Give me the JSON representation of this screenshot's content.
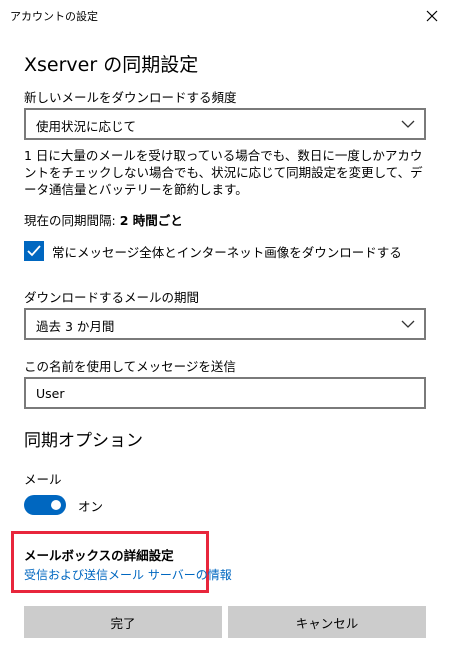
{
  "window": {
    "title": "アカウントの設定",
    "close_icon": "close-icon"
  },
  "heading": "Xserver の同期設定",
  "download_frequency": {
    "label": "新しいメールをダウンロードする頻度",
    "selected": "使用状況に応じて",
    "description": "1 日に大量のメールを受け取っている場合でも、数日に一度しかアカウントをチェックしない場合でも、状況に応じて同期設定を変更して、データ通信量とバッテリーを節約します。",
    "current_interval_label": "現在の同期間隔:",
    "current_interval_value": "2 時間ごと"
  },
  "full_message_option": {
    "label": "常にメッセージ全体とインターネット画像をダウンロードする",
    "checked": true
  },
  "download_period": {
    "label": "ダウンロードするメールの期間",
    "selected": "過去 3 か月間"
  },
  "sender_name": {
    "label": "この名前を使用してメッセージを送信",
    "value": "User"
  },
  "sync_options": {
    "heading": "同期オプション",
    "mail_label": "メール",
    "mail_toggle_text": "オン",
    "mail_on": true
  },
  "advanced": {
    "title": "メールボックスの詳細設定",
    "link": "受信および送信メール サーバーの情報"
  },
  "buttons": {
    "done": "完了",
    "cancel": "キャンセル"
  },
  "colors": {
    "accent": "#0067c0",
    "highlight_border": "#e8263c",
    "button_bg": "#cccccc",
    "field_border": "#7a7a7a"
  }
}
